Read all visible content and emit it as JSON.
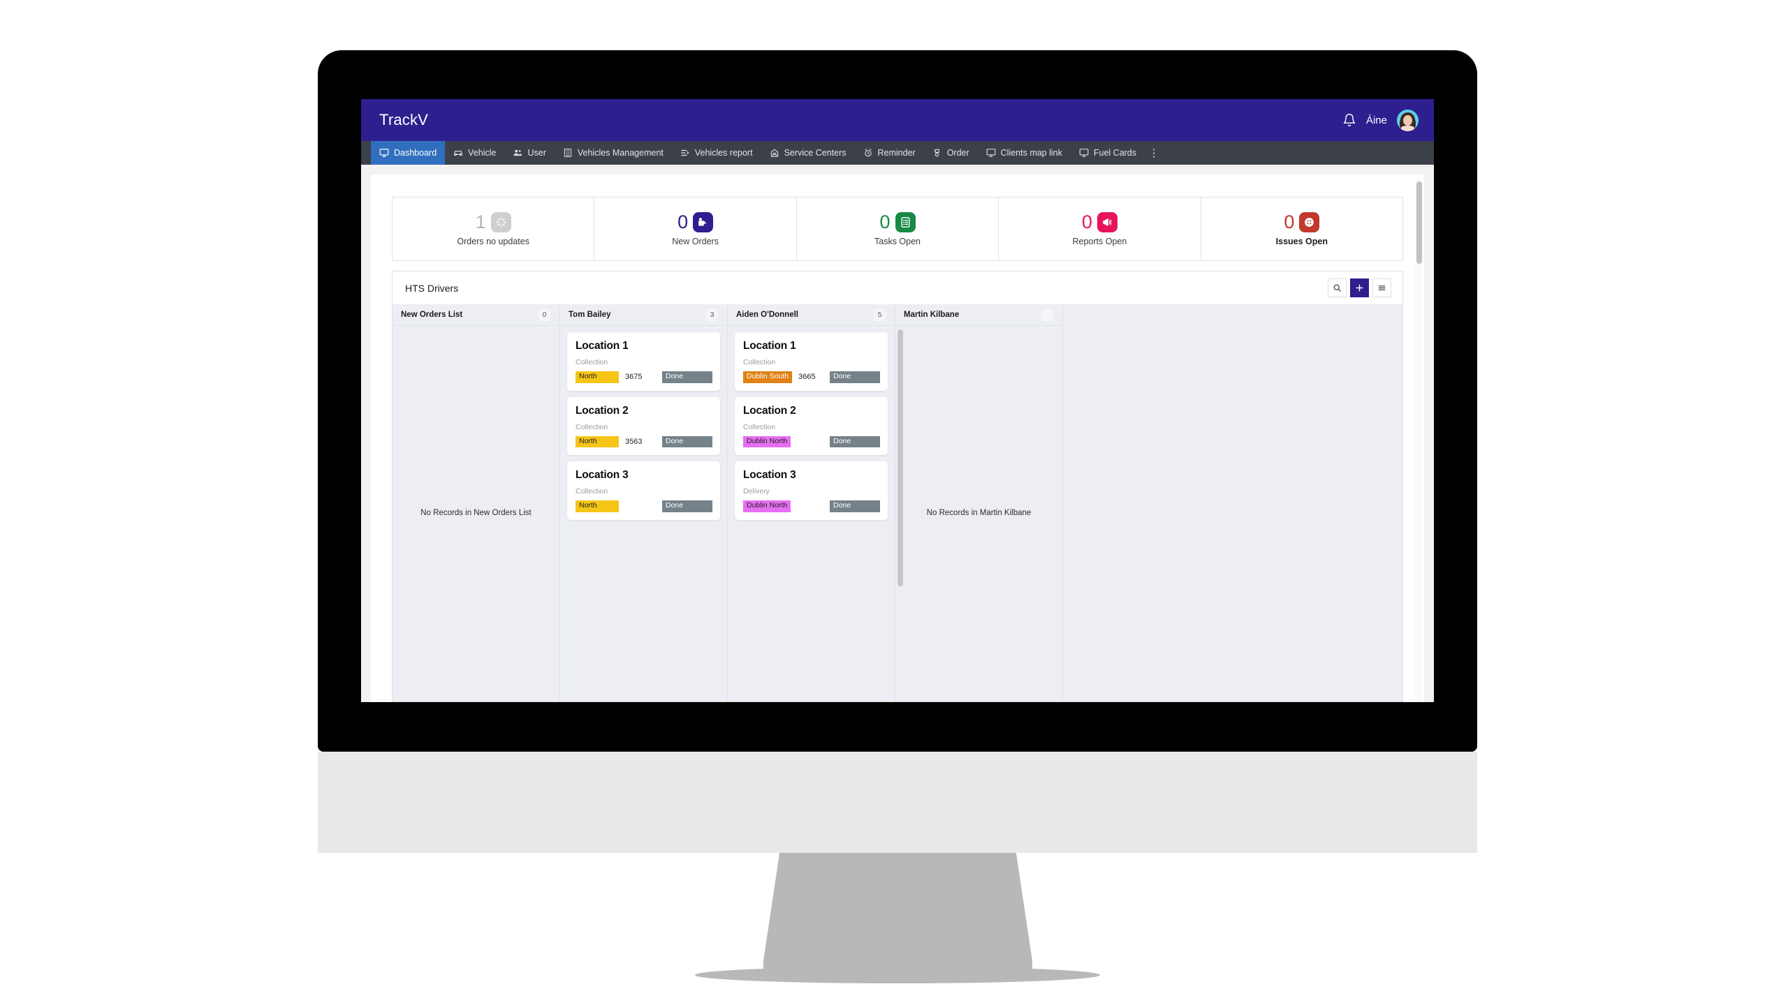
{
  "app": {
    "brand": "TrackV",
    "user_name": "Áine"
  },
  "nav": {
    "items": [
      {
        "label": "Dashboard",
        "icon": "monitor-icon",
        "active": true
      },
      {
        "label": "Vehicle",
        "icon": "car-icon",
        "active": false
      },
      {
        "label": "User",
        "icon": "users-icon",
        "active": false
      },
      {
        "label": "Vehicles Management",
        "icon": "grid-list-icon",
        "active": false
      },
      {
        "label": "Vehicles report",
        "icon": "report-arrow-icon",
        "active": false
      },
      {
        "label": "Service Centers",
        "icon": "garage-icon",
        "active": false
      },
      {
        "label": "Reminder",
        "icon": "alarm-clock-icon",
        "active": false
      },
      {
        "label": "Order",
        "icon": "order-icon",
        "active": false
      },
      {
        "label": "Clients map link",
        "icon": "monitor-icon",
        "active": false
      },
      {
        "label": "Fuel Cards",
        "icon": "monitor-icon",
        "active": false
      }
    ],
    "more_label": "⋮"
  },
  "kpis": [
    {
      "value": "1",
      "label": "Orders no updates",
      "num_color": "#b5b5b5",
      "badge_color": "#cfcfcf",
      "icon": "loading-spinner-icon",
      "bold_label": false
    },
    {
      "value": "0",
      "label": "New Orders",
      "num_color": "#2e1f8f",
      "badge_color": "#2e1f8f",
      "icon": "new-order-icon",
      "bold_label": false
    },
    {
      "value": "0",
      "label": "Tasks Open",
      "num_color": "#178a46",
      "badge_color": "#178a46",
      "icon": "checklist-icon",
      "bold_label": false
    },
    {
      "value": "0",
      "label": "Reports Open",
      "num_color": "#e6145c",
      "badge_color": "#e6145c",
      "icon": "megaphone-icon",
      "bold_label": false
    },
    {
      "value": "0",
      "label": "Issues Open",
      "num_color": "#c0392b",
      "badge_color": "#c0392b",
      "icon": "issues-dots-icon",
      "bold_label": true
    }
  ],
  "board": {
    "title": "HTS Drivers",
    "actions": {
      "search": "search-icon",
      "add": "plus-icon",
      "menu": "hamburger-icon"
    },
    "columns": [
      {
        "name": "New Orders List",
        "count": "0",
        "empty_text": "No Records in New Orders List",
        "cards": []
      },
      {
        "name": "Tom Bailey",
        "count": "3",
        "empty_text": "",
        "cards": [
          {
            "title": "Location 1",
            "subtitle": "Collection",
            "tag": "North",
            "tag_bg": "#f5c518",
            "tag_fg": "#1f1f1f",
            "number": "3675",
            "status": "Done"
          },
          {
            "title": "Location 2",
            "subtitle": "Collection",
            "tag": "North",
            "tag_bg": "#f5c518",
            "tag_fg": "#1f1f1f",
            "number": "3563",
            "status": "Done"
          },
          {
            "title": "Location 3",
            "subtitle": "Collection",
            "tag": "North",
            "tag_bg": "#f5c518",
            "tag_fg": "#1f1f1f",
            "number": "",
            "status": "Done"
          }
        ]
      },
      {
        "name": "Aiden O'Donnell",
        "count": "5",
        "empty_text": "",
        "cards": [
          {
            "title": "Location 1",
            "subtitle": "Collection",
            "tag": "Dublin South",
            "tag_bg": "#e08214",
            "tag_fg": "#ffffff",
            "number": "3665",
            "status": "Done"
          },
          {
            "title": "Location 2",
            "subtitle": "Collection",
            "tag": "Dublin North",
            "tag_bg": "#e76ef2",
            "tag_fg": "#1f1f1f",
            "number": "",
            "status": "Done"
          },
          {
            "title": "Location 3",
            "subtitle": "Delivery",
            "tag": "Dublin North",
            "tag_bg": "#e76ef2",
            "tag_fg": "#1f1f1f",
            "number": "",
            "status": "Done"
          }
        ]
      },
      {
        "name": "Martin Kilbane",
        "count": "",
        "empty_text": "No Records in Martin Kilbane",
        "cards": []
      }
    ]
  }
}
